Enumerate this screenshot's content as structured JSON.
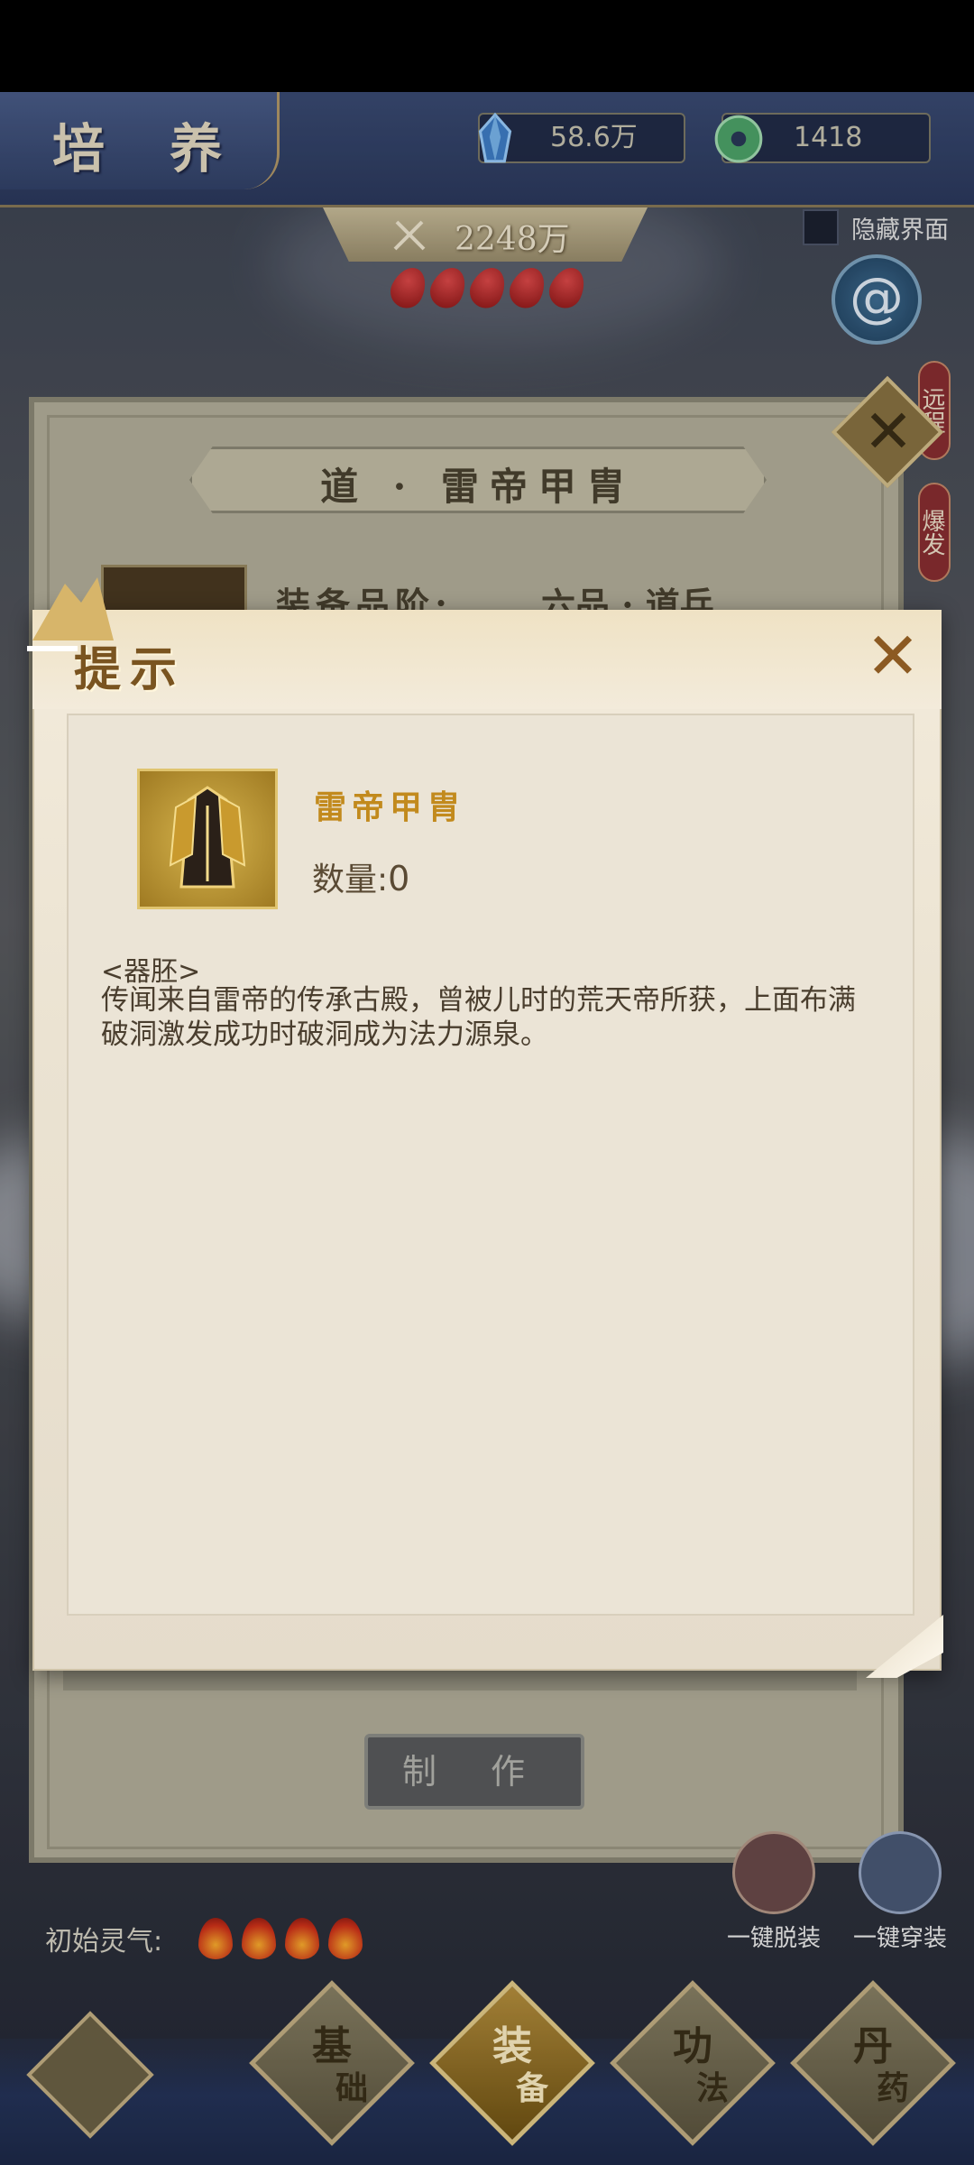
{
  "header": {
    "title": "培 养",
    "currencies": [
      {
        "icon": "crystal-icon",
        "value": "58.6万"
      },
      {
        "icon": "jade-coin-icon",
        "value": "1418"
      }
    ]
  },
  "power": {
    "value": "2248万",
    "blood_drops": 5
  },
  "hide_ui": {
    "label": "隐藏界面",
    "checked": false
  },
  "side_tabs": {
    "remote": "远程",
    "burst": "爆发"
  },
  "background_panel": {
    "title": "道 · 雷帝甲胄",
    "grade_label": "装备品阶:",
    "grade_value": "六品 · 道兵",
    "make_button": "制 作"
  },
  "dialog": {
    "title": "提示",
    "item": {
      "name": "雷帝甲胄",
      "quantity_label": "数量:",
      "quantity": "0",
      "type": "<器胚>",
      "description": "传闻来自雷帝的传承古殿，曾被儿时的荒天帝所获，上面布满破洞激发成功时破洞成为法力源泉。"
    }
  },
  "bottom": {
    "initial_qi_label": "初始灵气:",
    "flames": 4,
    "actions": {
      "remove_all": "一键脱装",
      "equip_all": "一键穿装"
    },
    "nav": [
      {
        "line1": "基",
        "line2": "础",
        "active": false
      },
      {
        "line1": "装",
        "line2": "备",
        "active": true
      },
      {
        "line1": "功",
        "line2": "法",
        "active": false
      },
      {
        "line1": "丹",
        "line2": "药",
        "active": false
      }
    ]
  },
  "colors": {
    "accent_gold": "#c28a1d",
    "dialog_bg": "#ebe4d6",
    "header_blue": "#2c3a5e"
  }
}
